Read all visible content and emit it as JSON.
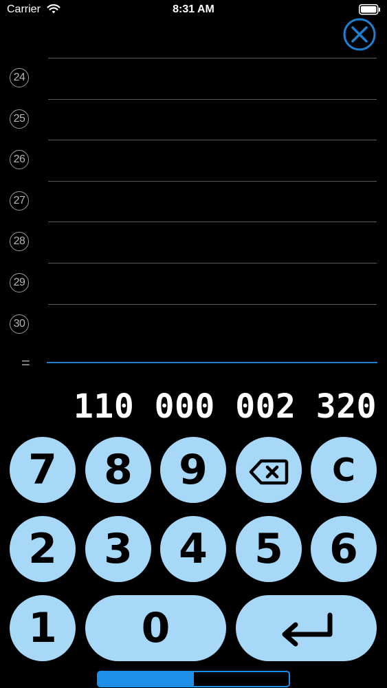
{
  "status_bar": {
    "carrier": "Carrier",
    "time": "8:31 AM"
  },
  "close_button": {
    "icon": "close-icon",
    "color": "#1f7fd1"
  },
  "rows": [
    {
      "number": "24"
    },
    {
      "number": "25"
    },
    {
      "number": "26"
    },
    {
      "number": "27"
    },
    {
      "number": "28"
    },
    {
      "number": "29"
    },
    {
      "number": "30"
    }
  ],
  "total": {
    "equals": "=",
    "value": "110 000 002 320"
  },
  "keypad": {
    "row1": [
      "7",
      "8",
      "9",
      "⌫",
      "C"
    ],
    "row2": [
      "2",
      "3",
      "4",
      "5",
      "6"
    ],
    "row3": [
      "1",
      "0",
      "↵"
    ]
  },
  "progress": {
    "fraction": 0.5
  },
  "colors": {
    "key_background": "#a8d8f8",
    "accent": "#1f8fe8"
  }
}
